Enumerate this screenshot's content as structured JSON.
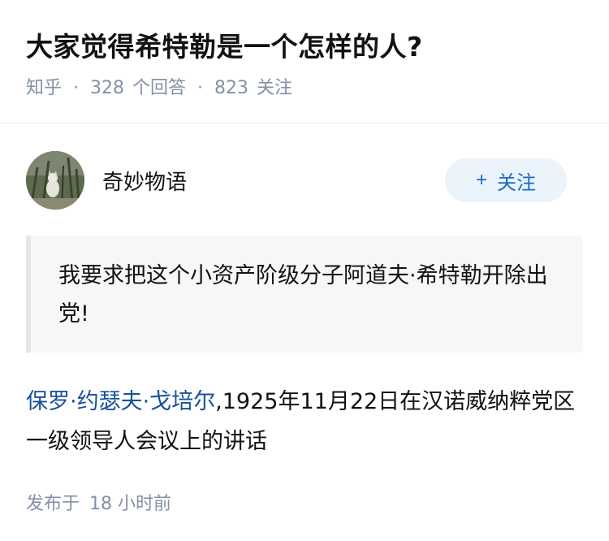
{
  "question": {
    "title": "大家觉得希特勒是一个怎样的人?",
    "source": "知乎",
    "answer_count": "328",
    "answer_label": "个回答",
    "follow_count": "823",
    "follow_label": "关注",
    "separator": "·"
  },
  "answer": {
    "author": {
      "name": "奇妙物语",
      "avatar_icon": "cat-photo-avatar"
    },
    "follow_button": {
      "plus": "+",
      "label": "关注"
    },
    "quote": "我要求把这个小资产阶级分子阿道夫·希特勒开除出党!",
    "citation": {
      "link_text": "保罗·约瑟夫·戈培尔",
      "rest_text": ",1925年11月22日在汉诺威纳粹党区一级领导人会议上的讲话"
    },
    "published": {
      "label": "发布于",
      "value": "18 小时前"
    }
  },
  "colors": {
    "link": "#175199",
    "follow_button_bg": "#ebf3fb",
    "follow_button_text": "#1a6dc4",
    "meta": "#8590a6"
  }
}
